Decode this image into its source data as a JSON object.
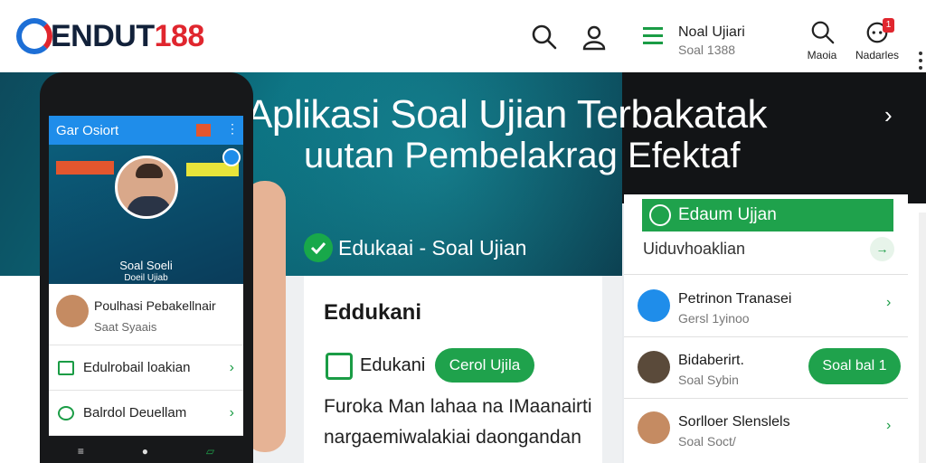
{
  "brand": {
    "logo_text": "ENDUT",
    "logo_number": "188"
  },
  "header": {
    "search_icon": "search-icon",
    "user_icon": "user-icon"
  },
  "hero": {
    "title": "Aplikasi Soal Ujian Terbakatak",
    "subtitle": "uutan Pembelakrag Efektaf",
    "badge": "Edukaai - Soal Ujian"
  },
  "phone": {
    "app_title": "Gar Osiort",
    "profile_name": "Soal Soeli",
    "profile_sub": "Doeil Ujiab",
    "card": {
      "title": "Poulhasi Pebakellnair",
      "sub": "Saat Syaais"
    },
    "rows": [
      {
        "label": "Edulrobail loakian"
      },
      {
        "label": "Balrdol Deuellam"
      }
    ]
  },
  "middle": {
    "heading": "Eddukani",
    "label": "Edukani",
    "button": "Cerol Ujila",
    "para1": "Furoka Man lahaa na IMaanairti",
    "para2": "nargaemiwalakiai daongandan"
  },
  "right": {
    "title": "Noal Ujiari",
    "sub": "Soal 1388",
    "icon_labels": [
      "Maoia",
      "Nadarles"
    ],
    "notif_count": "1",
    "green_item": "Edaum Ujjan",
    "row1": "Uiduvhoaklian",
    "items": [
      {
        "title": "Petrinon Tranasei",
        "sub": "Gersl 1yinoo"
      },
      {
        "title": "Bidaberirt.",
        "sub": "Soal Sybin"
      },
      {
        "title": "Sorlloer Slenslels",
        "sub": "Soal Soct/"
      }
    ],
    "button": "Soal bal 1"
  },
  "colors": {
    "accent": "#1fa24c",
    "brand_blue": "#1d6fd6",
    "brand_red": "#e0262e",
    "hero_teal": "#0a6a7a"
  }
}
